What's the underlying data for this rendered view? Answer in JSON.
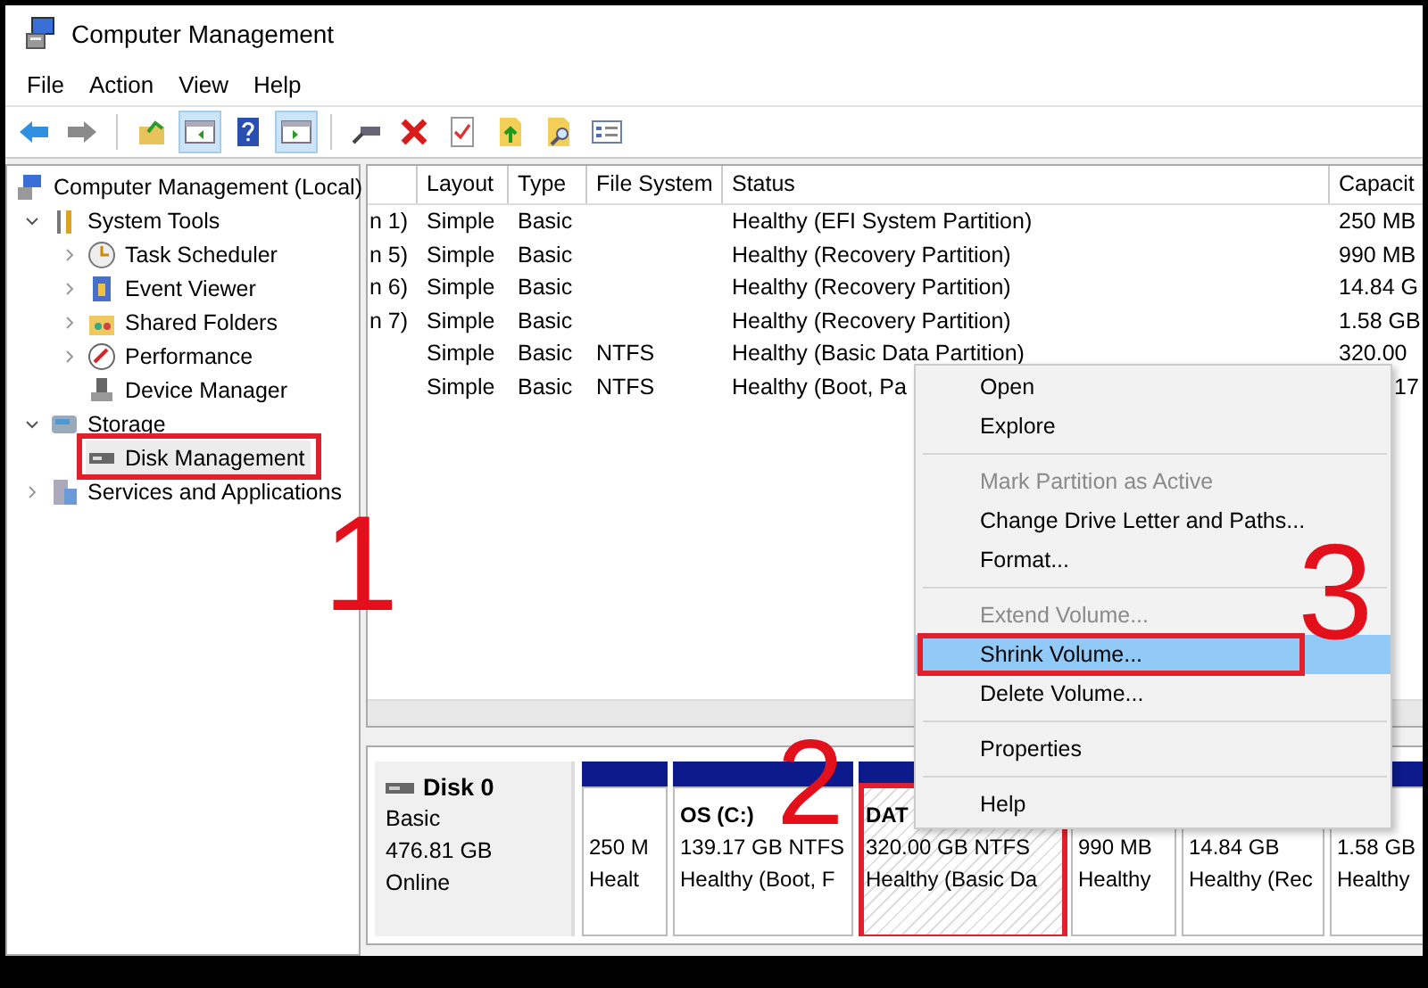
{
  "window": {
    "title": "Computer Management"
  },
  "menu": [
    "File",
    "Action",
    "View",
    "Help"
  ],
  "toolbar": [
    {
      "kind": "back",
      "pressed": false
    },
    {
      "kind": "forward",
      "pressed": false
    },
    {
      "kind": "up-folder",
      "pressed": false
    },
    {
      "kind": "tree-pane",
      "pressed": true
    },
    {
      "kind": "help",
      "pressed": false
    },
    {
      "kind": "action-pane",
      "pressed": true
    },
    {
      "kind": "connect",
      "pressed": false
    },
    {
      "kind": "delete",
      "pressed": false
    },
    {
      "kind": "checklist",
      "pressed": false
    },
    {
      "kind": "export",
      "pressed": false
    },
    {
      "kind": "find",
      "pressed": false
    },
    {
      "kind": "properties",
      "pressed": false
    }
  ],
  "tree": [
    {
      "label": "Computer Management (Local)",
      "kind": "computer",
      "selected": false,
      "highlighted": false,
      "children": [
        {
          "label": "System Tools",
          "kind": "tools",
          "expanded": true,
          "selected": false,
          "highlighted": false,
          "children": [
            {
              "label": "Task Scheduler",
              "kind": "clock",
              "expanded": false,
              "selected": false,
              "highlighted": false
            },
            {
              "label": "Event Viewer",
              "kind": "log",
              "expanded": false,
              "selected": false,
              "highlighted": false
            },
            {
              "label": "Shared Folders",
              "kind": "shared",
              "expanded": false,
              "selected": false,
              "highlighted": false
            },
            {
              "label": "Performance",
              "kind": "performance",
              "expanded": false,
              "selected": false,
              "highlighted": false
            },
            {
              "label": "Device Manager",
              "kind": "device",
              "selected": false,
              "highlighted": false
            }
          ]
        },
        {
          "label": "Storage",
          "kind": "storage",
          "expanded": true,
          "selected": false,
          "highlighted": false,
          "children": [
            {
              "label": "Disk Management",
              "kind": "disk",
              "selected": true,
              "highlighted": true
            }
          ]
        },
        {
          "label": "Services and Applications",
          "kind": "services",
          "expanded": false,
          "selected": false,
          "highlighted": false
        }
      ]
    }
  ],
  "table": {
    "columns": [
      "Layout",
      "Type",
      "File System",
      "Status",
      "Capacit"
    ],
    "rows": [
      {
        "column_1": "n 1)",
        "layout": "Simple",
        "type": "Basic",
        "status": "Healthy (EFI System Partition)",
        "capacity": "250 MB"
      },
      {
        "column_1": "n 5)",
        "layout": "Simple",
        "type": "Basic",
        "status": "Healthy (Recovery Partition)",
        "capacity": "990 MB"
      },
      {
        "column_1": "n 6)",
        "layout": "Simple",
        "type": "Basic",
        "status": "Healthy (Recovery Partition)",
        "capacity": "14.84 G"
      },
      {
        "column_1": "n 7)",
        "layout": "Simple",
        "type": "Basic",
        "status": "Healthy (Recovery Partition)",
        "capacity": "1.58 GB"
      },
      {
        "layout": "Simple",
        "type": "Basic",
        "file_system": "NTFS",
        "status": "Healthy (Basic Data Partition)",
        "capacity": "320.00"
      },
      {
        "layout": "Simple",
        "type": "Basic",
        "file_system": "NTFS",
        "status": "Healthy (Boot, Pa",
        "capacity": "17"
      }
    ]
  },
  "disk": {
    "name": "Disk 0",
    "type": "Basic",
    "size": "476.81 GB",
    "state": "Online",
    "partitions": [
      {
        "size": "250 M",
        "status": "Healt",
        "selected": false,
        "highlighted": false
      },
      {
        "name": "OS  (C:)",
        "size": "139.17 GB NTFS",
        "status": "Healthy (Boot, F",
        "selected": false,
        "highlighted": false
      },
      {
        "name": "DAT",
        "size": "320.00 GB NTFS",
        "status": "Healthy (Basic Da",
        "selected": true,
        "highlighted": true
      },
      {
        "size": "990 MB",
        "status": "Healthy",
        "selected": false,
        "highlighted": false
      },
      {
        "size": "14.84 GB",
        "status": "Healthy (Rec",
        "selected": false,
        "highlighted": false
      },
      {
        "size": "1.58 GB",
        "status": "Healthy",
        "selected": false,
        "highlighted": false
      }
    ]
  },
  "context_menu": [
    {
      "kind": "item",
      "label": "Open",
      "disabled": false,
      "selected": false,
      "highlighted": false
    },
    {
      "kind": "item",
      "label": "Explore",
      "disabled": false,
      "selected": false,
      "highlighted": false
    },
    {
      "kind": "separator"
    },
    {
      "kind": "item",
      "label": "Mark Partition as Active",
      "disabled": true,
      "selected": false,
      "highlighted": false
    },
    {
      "kind": "item",
      "label": "Change Drive Letter and Paths...",
      "disabled": false,
      "selected": false,
      "highlighted": false
    },
    {
      "kind": "item",
      "label": "Format...",
      "disabled": false,
      "selected": false,
      "highlighted": false
    },
    {
      "kind": "separator"
    },
    {
      "kind": "item",
      "label": "Extend Volume...",
      "disabled": true,
      "selected": false,
      "highlighted": false
    },
    {
      "kind": "item",
      "label": "Shrink Volume...",
      "disabled": false,
      "selected": true,
      "highlighted": true
    },
    {
      "kind": "item",
      "label": "Delete Volume...",
      "disabled": false,
      "selected": false,
      "highlighted": false
    },
    {
      "kind": "separator"
    },
    {
      "kind": "item",
      "label": "Properties",
      "disabled": false,
      "selected": false,
      "highlighted": false
    },
    {
      "kind": "separator"
    },
    {
      "kind": "item",
      "label": "Help",
      "disabled": false,
      "selected": false,
      "highlighted": false
    }
  ],
  "step_numbers": [
    "1",
    "2",
    "3"
  ]
}
